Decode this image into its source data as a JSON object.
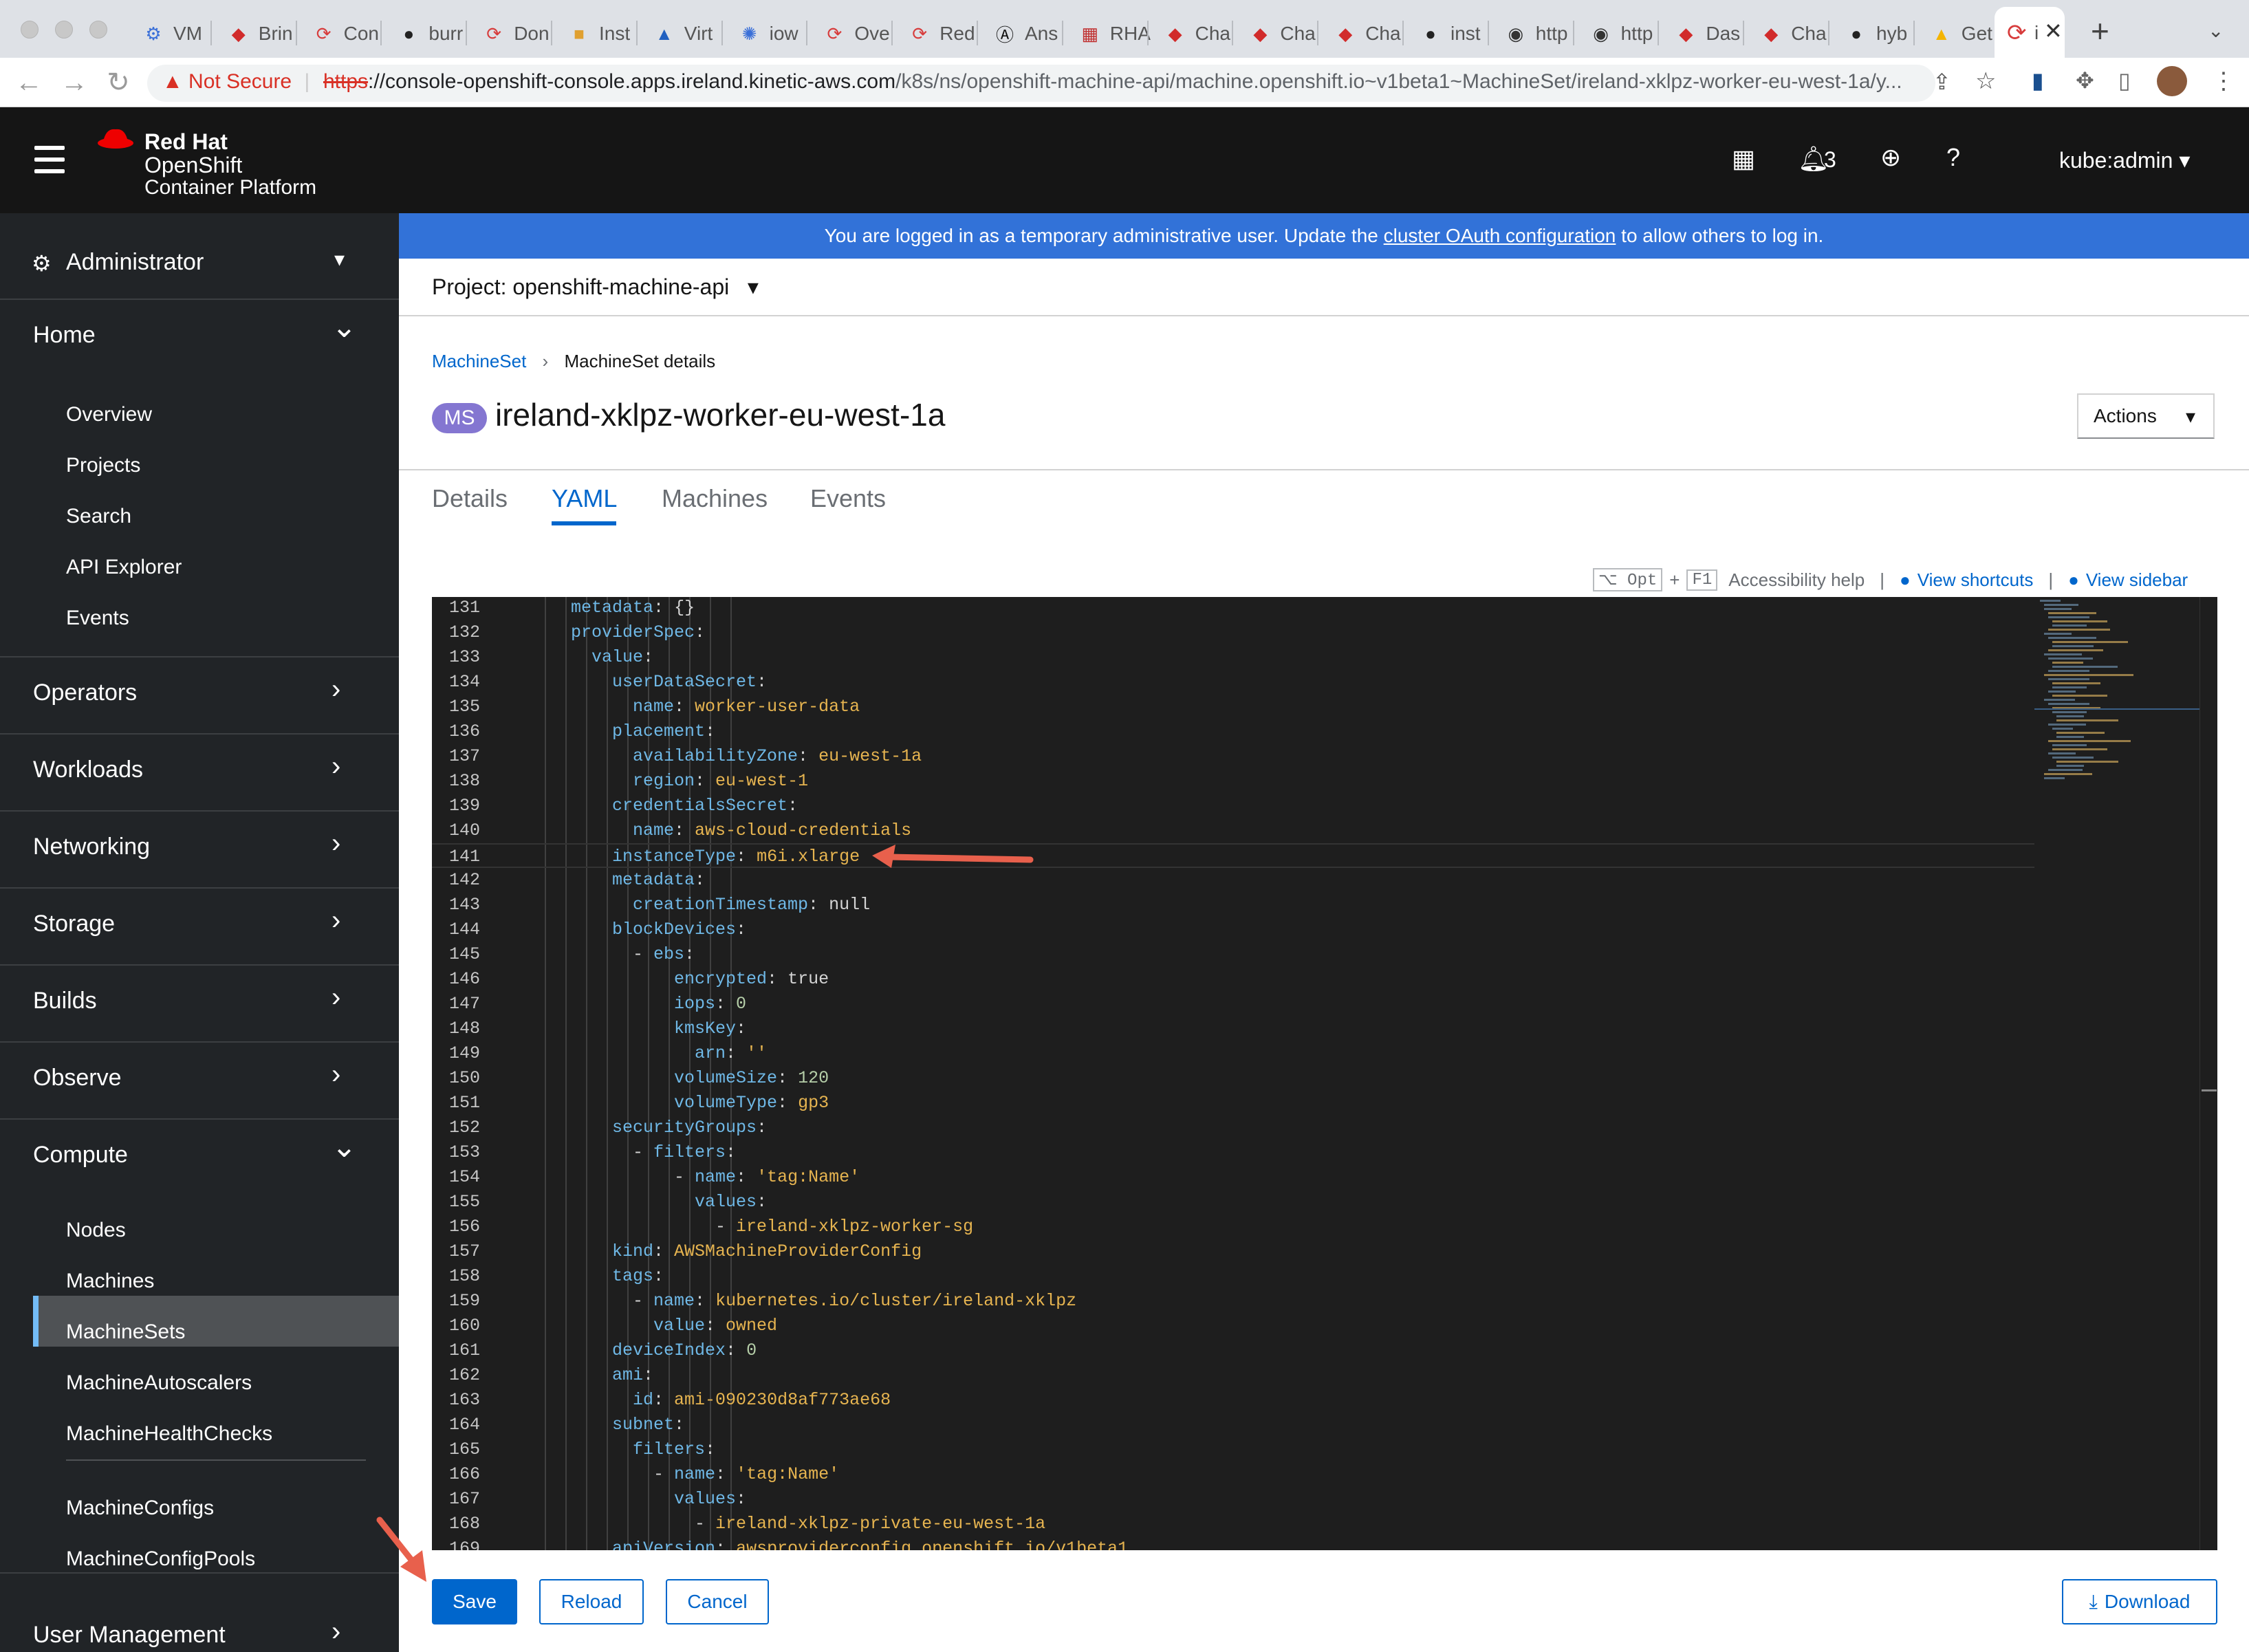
{
  "browser": {
    "tabs": [
      {
        "icon": "vm-icon",
        "label": "VM"
      },
      {
        "icon": "redhat-icon",
        "label": "Brin"
      },
      {
        "icon": "openshift-icon",
        "label": "Con"
      },
      {
        "icon": "github-icon",
        "label": "burr"
      },
      {
        "icon": "openshift-icon",
        "label": "Don"
      },
      {
        "icon": "box-icon",
        "label": "Inst"
      },
      {
        "icon": "triangle-icon",
        "label": "Virt"
      },
      {
        "icon": "gear-icon",
        "label": "iow"
      },
      {
        "icon": "openshift-icon",
        "label": "Ove"
      },
      {
        "icon": "openshift-icon",
        "label": "Red"
      },
      {
        "icon": "ansible-icon",
        "label": "Ans"
      },
      {
        "icon": "grid-icon",
        "label": "RHA"
      },
      {
        "icon": "redhat-icon",
        "label": "Cha"
      },
      {
        "icon": "redhat-icon",
        "label": "Cha"
      },
      {
        "icon": "redhat-icon",
        "label": "Cha"
      },
      {
        "icon": "github-icon",
        "label": "inst"
      },
      {
        "icon": "globe-icon",
        "label": "http"
      },
      {
        "icon": "globe-icon",
        "label": "http"
      },
      {
        "icon": "redhat-icon",
        "label": "Das"
      },
      {
        "icon": "redhat-icon",
        "label": "Cha"
      },
      {
        "icon": "github-icon",
        "label": "hyb"
      },
      {
        "icon": "drive-icon",
        "label": "Get"
      }
    ],
    "active_tab_label": "i",
    "security_label": "Not Secure",
    "url_scheme": "https",
    "url_host": "://console-openshift-console.apps.ireland.kinetic-aws.com",
    "url_path": "/k8s/ns/openshift-machine-api/machine.openshift.io~v1beta1~MachineSet/ireland-xklpz-worker-eu-west-1a/y..."
  },
  "masthead": {
    "brand_top": "Red Hat",
    "brand_mid": "OpenShift",
    "brand_bottom": "Container Platform",
    "notification_count": "3",
    "user": "kube:admin"
  },
  "sidebar": {
    "perspective": "Administrator",
    "sections": [
      {
        "label": "Home",
        "expanded": true,
        "items": [
          "Overview",
          "Projects",
          "Search",
          "API Explorer",
          "Events"
        ]
      },
      {
        "label": "Operators",
        "expanded": false
      },
      {
        "label": "Workloads",
        "expanded": false
      },
      {
        "label": "Networking",
        "expanded": false
      },
      {
        "label": "Storage",
        "expanded": false
      },
      {
        "label": "Builds",
        "expanded": false
      },
      {
        "label": "Observe",
        "expanded": false
      },
      {
        "label": "Compute",
        "expanded": true,
        "items": [
          "Nodes",
          "Machines",
          "MachineSets",
          "MachineAutoscalers",
          "MachineHealthChecks",
          "MachineConfigs",
          "MachineConfigPools"
        ]
      },
      {
        "label": "User Management",
        "expanded": false
      }
    ],
    "active_item": "MachineSets"
  },
  "banner": {
    "prefix": "You are logged in as a temporary administrative user. Update the ",
    "link": "cluster OAuth configuration",
    "suffix": " to allow others to log in."
  },
  "project": {
    "label": "Project: openshift-machine-api"
  },
  "page": {
    "breadcrumb_link": "MachineSet",
    "breadcrumb_current": "MachineSet details",
    "badge": "MS",
    "title": "ireland-xklpz-worker-eu-west-1a",
    "actions_label": "Actions",
    "tabs": [
      "Details",
      "YAML",
      "Machines",
      "Events"
    ],
    "active_tab": "YAML"
  },
  "editor_toolbar": {
    "key1": "⌥ Opt",
    "plus": "+",
    "key2": "F1",
    "accessibility": "Accessibility help",
    "sep": "|",
    "shortcuts": "View shortcuts",
    "sidebar": "View sidebar"
  },
  "yaml_lines": [
    {
      "n": "131",
      "indent": 3,
      "key": "metadata",
      "val": "{}",
      "vtype": "p"
    },
    {
      "n": "132",
      "indent": 3,
      "key": "providerSpec",
      "val": "",
      "vtype": "p"
    },
    {
      "n": "133",
      "indent": 4,
      "key": "value",
      "val": "",
      "vtype": "p"
    },
    {
      "n": "134",
      "indent": 5,
      "key": "userDataSecret",
      "val": "",
      "vtype": "p"
    },
    {
      "n": "135",
      "indent": 6,
      "key": "name",
      "val": "worker-user-data",
      "vtype": "v"
    },
    {
      "n": "136",
      "indent": 5,
      "key": "placement",
      "val": "",
      "vtype": "p"
    },
    {
      "n": "137",
      "indent": 6,
      "key": "availabilityZone",
      "val": "eu-west-1a",
      "vtype": "v"
    },
    {
      "n": "138",
      "indent": 6,
      "key": "region",
      "val": "eu-west-1",
      "vtype": "v"
    },
    {
      "n": "139",
      "indent": 5,
      "key": "credentialsSecret",
      "val": "",
      "vtype": "p"
    },
    {
      "n": "140",
      "indent": 6,
      "key": "name",
      "val": "aws-cloud-credentials",
      "vtype": "v"
    },
    {
      "n": "141",
      "indent": 5,
      "key": "instanceType",
      "val": "m6i.xlarge",
      "vtype": "v",
      "highlight": true
    },
    {
      "n": "142",
      "indent": 5,
      "key": "metadata",
      "val": "",
      "vtype": "p"
    },
    {
      "n": "143",
      "indent": 6,
      "key": "creationTimestamp",
      "val": "null",
      "vtype": "p"
    },
    {
      "n": "144",
      "indent": 5,
      "key": "blockDevices",
      "val": "",
      "vtype": "p"
    },
    {
      "n": "145",
      "indent": 6,
      "dash": true,
      "key": "ebs",
      "val": "",
      "vtype": "p"
    },
    {
      "n": "146",
      "indent": 8,
      "key": "encrypted",
      "val": "true",
      "vtype": "p"
    },
    {
      "n": "147",
      "indent": 8,
      "key": "iops",
      "val": "0",
      "vtype": "n"
    },
    {
      "n": "148",
      "indent": 8,
      "key": "kmsKey",
      "val": "",
      "vtype": "p"
    },
    {
      "n": "149",
      "indent": 9,
      "key": "arn",
      "val": "''",
      "vtype": "v"
    },
    {
      "n": "150",
      "indent": 8,
      "key": "volumeSize",
      "val": "120",
      "vtype": "n"
    },
    {
      "n": "151",
      "indent": 8,
      "key": "volumeType",
      "val": "gp3",
      "vtype": "v"
    },
    {
      "n": "152",
      "indent": 5,
      "key": "securityGroups",
      "val": "",
      "vtype": "p"
    },
    {
      "n": "153",
      "indent": 6,
      "dash": true,
      "key": "filters",
      "val": "",
      "vtype": "p"
    },
    {
      "n": "154",
      "indent": 8,
      "dash": true,
      "key": "name",
      "val": "'tag:Name'",
      "vtype": "v"
    },
    {
      "n": "155",
      "indent": 9,
      "key": "values",
      "val": "",
      "vtype": "p"
    },
    {
      "n": "156",
      "indent": 10,
      "dash": true,
      "key": "",
      "val": "ireland-xklpz-worker-sg",
      "vtype": "v"
    },
    {
      "n": "157",
      "indent": 5,
      "key": "kind",
      "val": "AWSMachineProviderConfig",
      "vtype": "v"
    },
    {
      "n": "158",
      "indent": 5,
      "key": "tags",
      "val": "",
      "vtype": "p"
    },
    {
      "n": "159",
      "indent": 6,
      "dash": true,
      "key": "name",
      "val": "kubernetes.io/cluster/ireland-xklpz",
      "vtype": "v"
    },
    {
      "n": "160",
      "indent": 7,
      "key": "value",
      "val": "owned",
      "vtype": "v"
    },
    {
      "n": "161",
      "indent": 5,
      "key": "deviceIndex",
      "val": "0",
      "vtype": "n"
    },
    {
      "n": "162",
      "indent": 5,
      "key": "ami",
      "val": "",
      "vtype": "p"
    },
    {
      "n": "163",
      "indent": 6,
      "key": "id",
      "val": "ami-090230d8af773ae68",
      "vtype": "v"
    },
    {
      "n": "164",
      "indent": 5,
      "key": "subnet",
      "val": "",
      "vtype": "p"
    },
    {
      "n": "165",
      "indent": 6,
      "key": "filters",
      "val": "",
      "vtype": "p"
    },
    {
      "n": "166",
      "indent": 7,
      "dash": true,
      "key": "name",
      "val": "'tag:Name'",
      "vtype": "v"
    },
    {
      "n": "167",
      "indent": 8,
      "key": "values",
      "val": "",
      "vtype": "p"
    },
    {
      "n": "168",
      "indent": 9,
      "dash": true,
      "key": "",
      "val": "ireland-xklpz-private-eu-west-1a",
      "vtype": "v"
    },
    {
      "n": "169",
      "indent": 5,
      "key": "apiVersion",
      "val": "awsproviderconfig.openshift.io/v1beta1",
      "vtype": "v"
    }
  ],
  "buttons": {
    "save": "Save",
    "reload": "Reload",
    "cancel": "Cancel",
    "download": "Download"
  },
  "colors": {
    "primary": "#0066cc",
    "banner": "#3272d8",
    "annotation_arrow": "#e8604c",
    "sidebar_bg": "#212427",
    "masthead_bg": "#151515"
  }
}
